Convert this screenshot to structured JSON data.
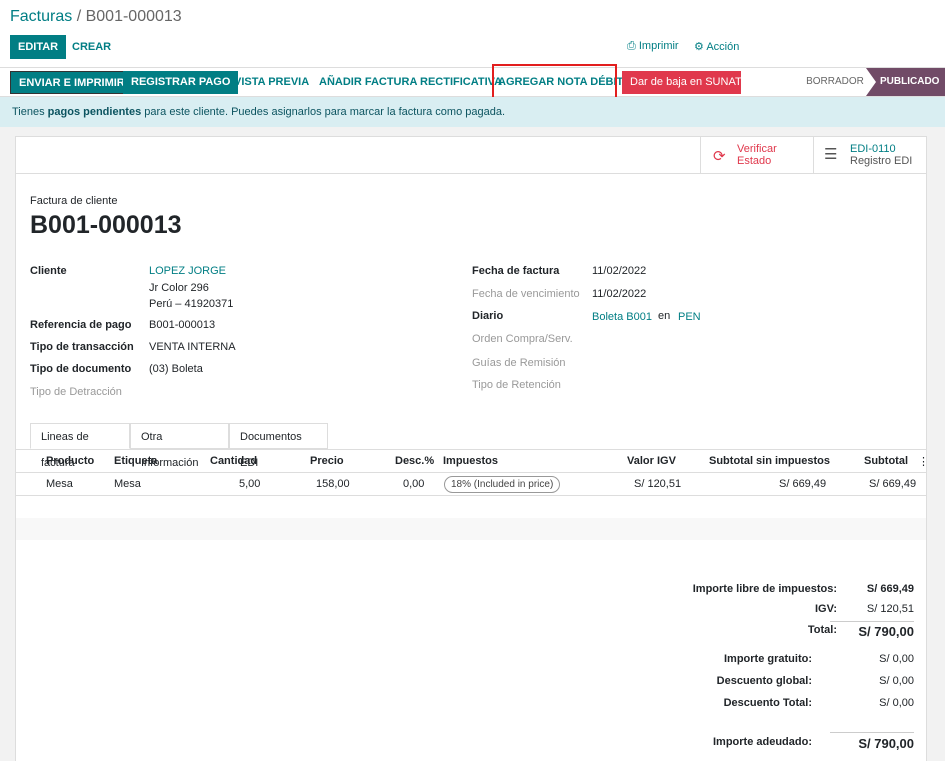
{
  "breadcrumb": {
    "parent": "Facturas",
    "sep": "/",
    "current": "B001-000013"
  },
  "control": {
    "edit": "EDITAR",
    "create": "CREAR",
    "print": "Imprimir",
    "action": "Acción"
  },
  "statusbar": {
    "buttons": [
      "ENVIAR E IMPRIMIR",
      "REGISTRAR PAGO",
      "VISTA PREVIA",
      "AÑADIR FACTURA RECTIFICATIVA",
      "AGREGAR NOTA DÉBITO",
      "Dar de baja en SUNAT"
    ],
    "states": [
      "BORRADOR",
      "PUBLICADO"
    ],
    "active_state": "PUBLICADO"
  },
  "alert": {
    "before": "Tienes ",
    "bold": "pagos pendientes",
    "after": " para este cliente. Puedes asignarlos para marcar la factura como pagada."
  },
  "smart_buttons": {
    "verify": {
      "line1": "Verificar",
      "line2": "Estado"
    },
    "edi": {
      "line1": "EDI-0110",
      "line2": "Registro EDI"
    }
  },
  "doc": {
    "subtitle": "Factura de cliente",
    "number": "B001-000013"
  },
  "left_fields": {
    "cliente_lbl": "Cliente",
    "cliente_name": "LOPEZ JORGE",
    "cliente_addr1": "Jr Color 296",
    "cliente_addr2": "Perú – 41920371",
    "ref_lbl": "Referencia de pago",
    "ref_val": "B001-000013",
    "trans_lbl": "Tipo de transacción",
    "trans_val": "VENTA INTERNA",
    "doc_lbl": "Tipo de documento",
    "doc_val": "(03) Boleta",
    "detr_lbl": "Tipo de Detracción"
  },
  "right_fields": {
    "fecha_lbl": "Fecha de factura",
    "fecha_val": "11/02/2022",
    "venc_lbl": "Fecha de vencimiento",
    "venc_val": "11/02/2022",
    "diario_lbl": "Diario",
    "diario_val": "Boleta B001",
    "diario_en": "en",
    "diario_cur": "PEN",
    "orden_lbl": "Orden Compra/Serv.",
    "guias_lbl": "Guías de Remisión",
    "ret_lbl": "Tipo de Retención"
  },
  "tabs": [
    "Lineas de factura",
    "Otra Información",
    "Documentos EDI"
  ],
  "table": {
    "headers": [
      "Producto",
      "Etiqueta",
      "Cantidad",
      "Precio",
      "Desc.%",
      "Impuestos",
      "Valor IGV",
      "Subtotal sin impuestos",
      "Subtotal"
    ],
    "row": {
      "producto": "Mesa",
      "etiqueta": "Mesa",
      "cantidad": "5,00",
      "precio": "158,00",
      "desc": "0,00",
      "impuestos": "18% (Included in price)",
      "igv": "S/ 120,51",
      "subtotal_sin": "S/ 669,49",
      "subtotal": "S/ 669,49"
    }
  },
  "totals": {
    "libre_lbl": "Importe libre de impuestos:",
    "libre_val": "S/ 669,49",
    "igv_lbl": "IGV:",
    "igv_val": "S/ 120,51",
    "total_lbl": "Total:",
    "total_val": "S/ 790,00",
    "gratuito_lbl": "Importe gratuito:",
    "gratuito_val": "S/ 0,00",
    "global_lbl": "Descuento global:",
    "global_val": "S/ 0,00",
    "desc_total_lbl": "Descuento Total:",
    "desc_total_val": "S/ 0,00",
    "adeudado_lbl": "Importe adeudado:",
    "adeudado_val": "S/ 790,00"
  }
}
